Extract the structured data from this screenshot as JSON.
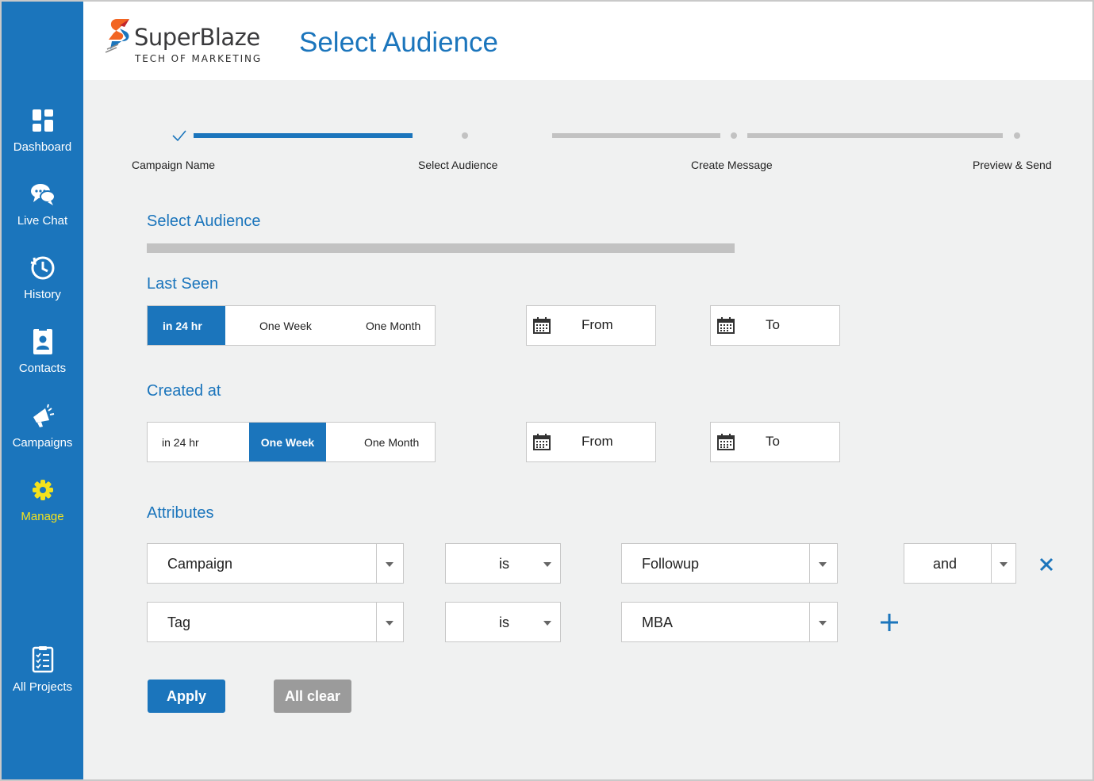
{
  "brand": {
    "name": "SuperBlaze",
    "tagline": "TECH OF MARKETING"
  },
  "header": {
    "title": "Select Audience"
  },
  "sidebar": {
    "items": [
      {
        "label": "Dashboard",
        "icon": "dashboard-icon"
      },
      {
        "label": "Live Chat",
        "icon": "chat-icon"
      },
      {
        "label": "History",
        "icon": "history-icon"
      },
      {
        "label": "Contacts",
        "icon": "contacts-icon"
      },
      {
        "label": "Campaigns",
        "icon": "megaphone-icon"
      },
      {
        "label": "Manage",
        "icon": "gear-icon",
        "active": true
      },
      {
        "label": "All Projects",
        "icon": "clipboard-icon"
      }
    ]
  },
  "stepper": {
    "steps": [
      "Campaign Name",
      "Select Audience",
      "Create Message",
      "Preview & Send"
    ],
    "completed": 1
  },
  "audience": {
    "title": "Select Audience",
    "last_seen": {
      "title": "Last Seen",
      "options": [
        "in 24 hr",
        "One Week",
        "One Month"
      ],
      "selected": "in 24 hr",
      "from": "From",
      "to": "To"
    },
    "created_at": {
      "title": "Created at",
      "options": [
        "in 24 hr",
        "One Week",
        "One Month"
      ],
      "selected": "One Week",
      "from": "From",
      "to": "To"
    }
  },
  "attributes": {
    "title": "Attributes",
    "rows": [
      {
        "field": "Campaign",
        "operator": "is",
        "value": "Followup",
        "conjunction": "and"
      },
      {
        "field": "Tag",
        "operator": "is",
        "value": "MBA"
      }
    ]
  },
  "actions": {
    "apply": "Apply",
    "clear": "All clear"
  },
  "colors": {
    "primary": "#1b75bc",
    "active_nav": "#f4e21c",
    "clear_button": "#9b9b9b",
    "track": "#c2c2c2"
  }
}
